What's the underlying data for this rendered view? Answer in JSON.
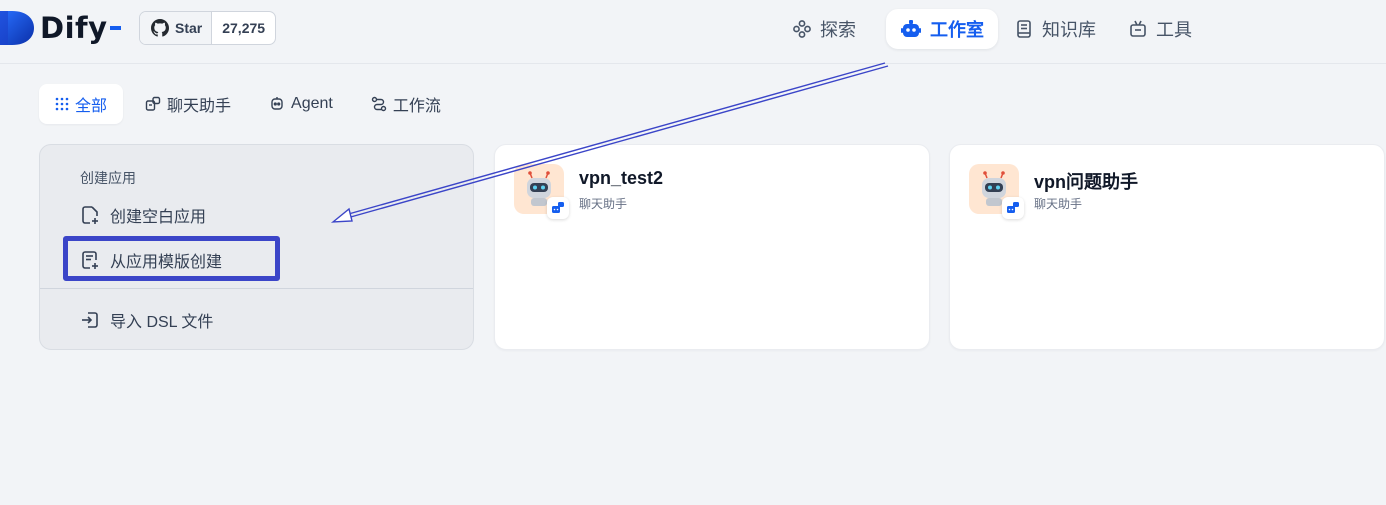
{
  "header": {
    "logo_text": "Dify",
    "github": {
      "star_label": "Star",
      "count": "27,275"
    },
    "nav": [
      {
        "label": "探索",
        "icon": "explore-icon"
      },
      {
        "label": "工作室",
        "icon": "robot-icon",
        "active": true
      },
      {
        "label": "知识库",
        "icon": "book-icon"
      },
      {
        "label": "工具",
        "icon": "tools-icon"
      }
    ]
  },
  "tabs": [
    {
      "label": "全部",
      "icon": "grid-icon",
      "active": true
    },
    {
      "label": "聊天助手",
      "icon": "chat-icon"
    },
    {
      "label": "Agent",
      "icon": "agent-icon"
    },
    {
      "label": "工作流",
      "icon": "workflow-icon"
    }
  ],
  "create": {
    "title": "创建应用",
    "blank": "创建空白应用",
    "from_template": "从应用模版创建",
    "import_dsl": "导入 DSL 文件"
  },
  "apps": [
    {
      "name": "vpn_test2",
      "type": "聊天助手",
      "icon": "robot-avatar-icon"
    },
    {
      "name": "vpn问题助手",
      "type": "聊天助手",
      "icon": "robot-avatar-icon"
    }
  ],
  "colors": {
    "accent": "#155eef",
    "background": "#f2f4f7",
    "annotation": "#3b45c8",
    "app_icon_bg": "#ffe6d2"
  }
}
